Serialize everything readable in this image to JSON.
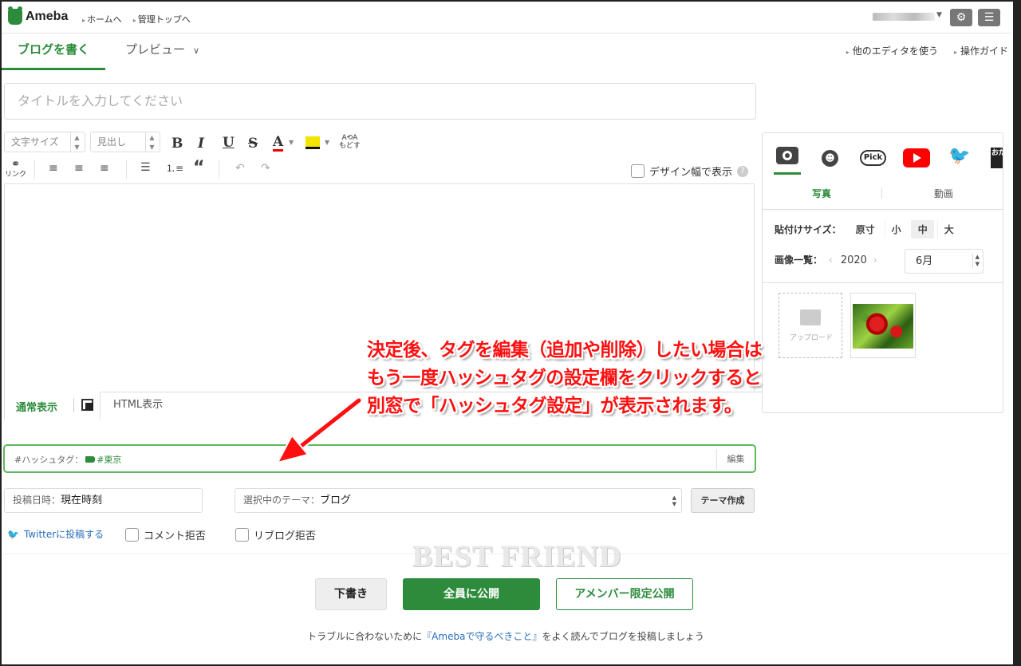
{
  "header": {
    "logo": "Ameba",
    "links": [
      "ホームへ",
      "管理トップへ"
    ],
    "settings_icon": "gear-icon",
    "menu_icon": "hamburger-icon"
  },
  "tabs": {
    "write": "ブログを書く",
    "preview": "プレビュー",
    "right_links": [
      "他のエディタを使う",
      "操作ガイド"
    ]
  },
  "title_input": {
    "placeholder": "タイトルを入力してください"
  },
  "toolbar": {
    "font_size": "文字サイズ",
    "heading": "見出し",
    "bold": "B",
    "italic": "I",
    "underline": "U",
    "strike": "S",
    "font_color": "A",
    "restore": "もどす",
    "link": "リンク",
    "design_width": "デザイン幅で表示"
  },
  "editor_modes": {
    "normal": "通常表示",
    "html": "HTML表示"
  },
  "hashtag": {
    "label": "#ハッシュタグ：",
    "tag": "#東京",
    "edit": "編集"
  },
  "post": {
    "date_label": "投稿日時：",
    "date_value": "現在時刻",
    "theme_label": "選択中のテーマ：",
    "theme_value": "ブログ",
    "theme_button": "テーマ作成",
    "twitter": "Twitterに投稿する",
    "no_comment": "コメント拒否",
    "no_reblog": "リブログ拒否"
  },
  "watermark": "BEST FRIEND",
  "buttons": {
    "draft": "下書き",
    "publish": "全員に公開",
    "members": "アメンバー限定公開"
  },
  "footnote": {
    "pre": "トラブルに合わないために",
    "link": "『Amebaで守るべきこと』",
    "post": "をよく読んでブログを投稿しましょう"
  },
  "panel": {
    "tabs": [
      "写真",
      "動画"
    ],
    "pick": "Pick",
    "oda": "おだ",
    "size_label": "貼付けサイズ：",
    "sizes": [
      "原寸",
      "小",
      "中",
      "大"
    ],
    "images_label": "画像一覧：",
    "year": "2020",
    "month": "6月",
    "upload": "アップロード"
  },
  "annotation": {
    "lines": [
      "決定後、タグを編集（追加や削除）したい場合は",
      "もう一度ハッシュタグの設定欄をクリックすると",
      "別窓で「ハッシュタグ設定」が表示されます。"
    ]
  }
}
